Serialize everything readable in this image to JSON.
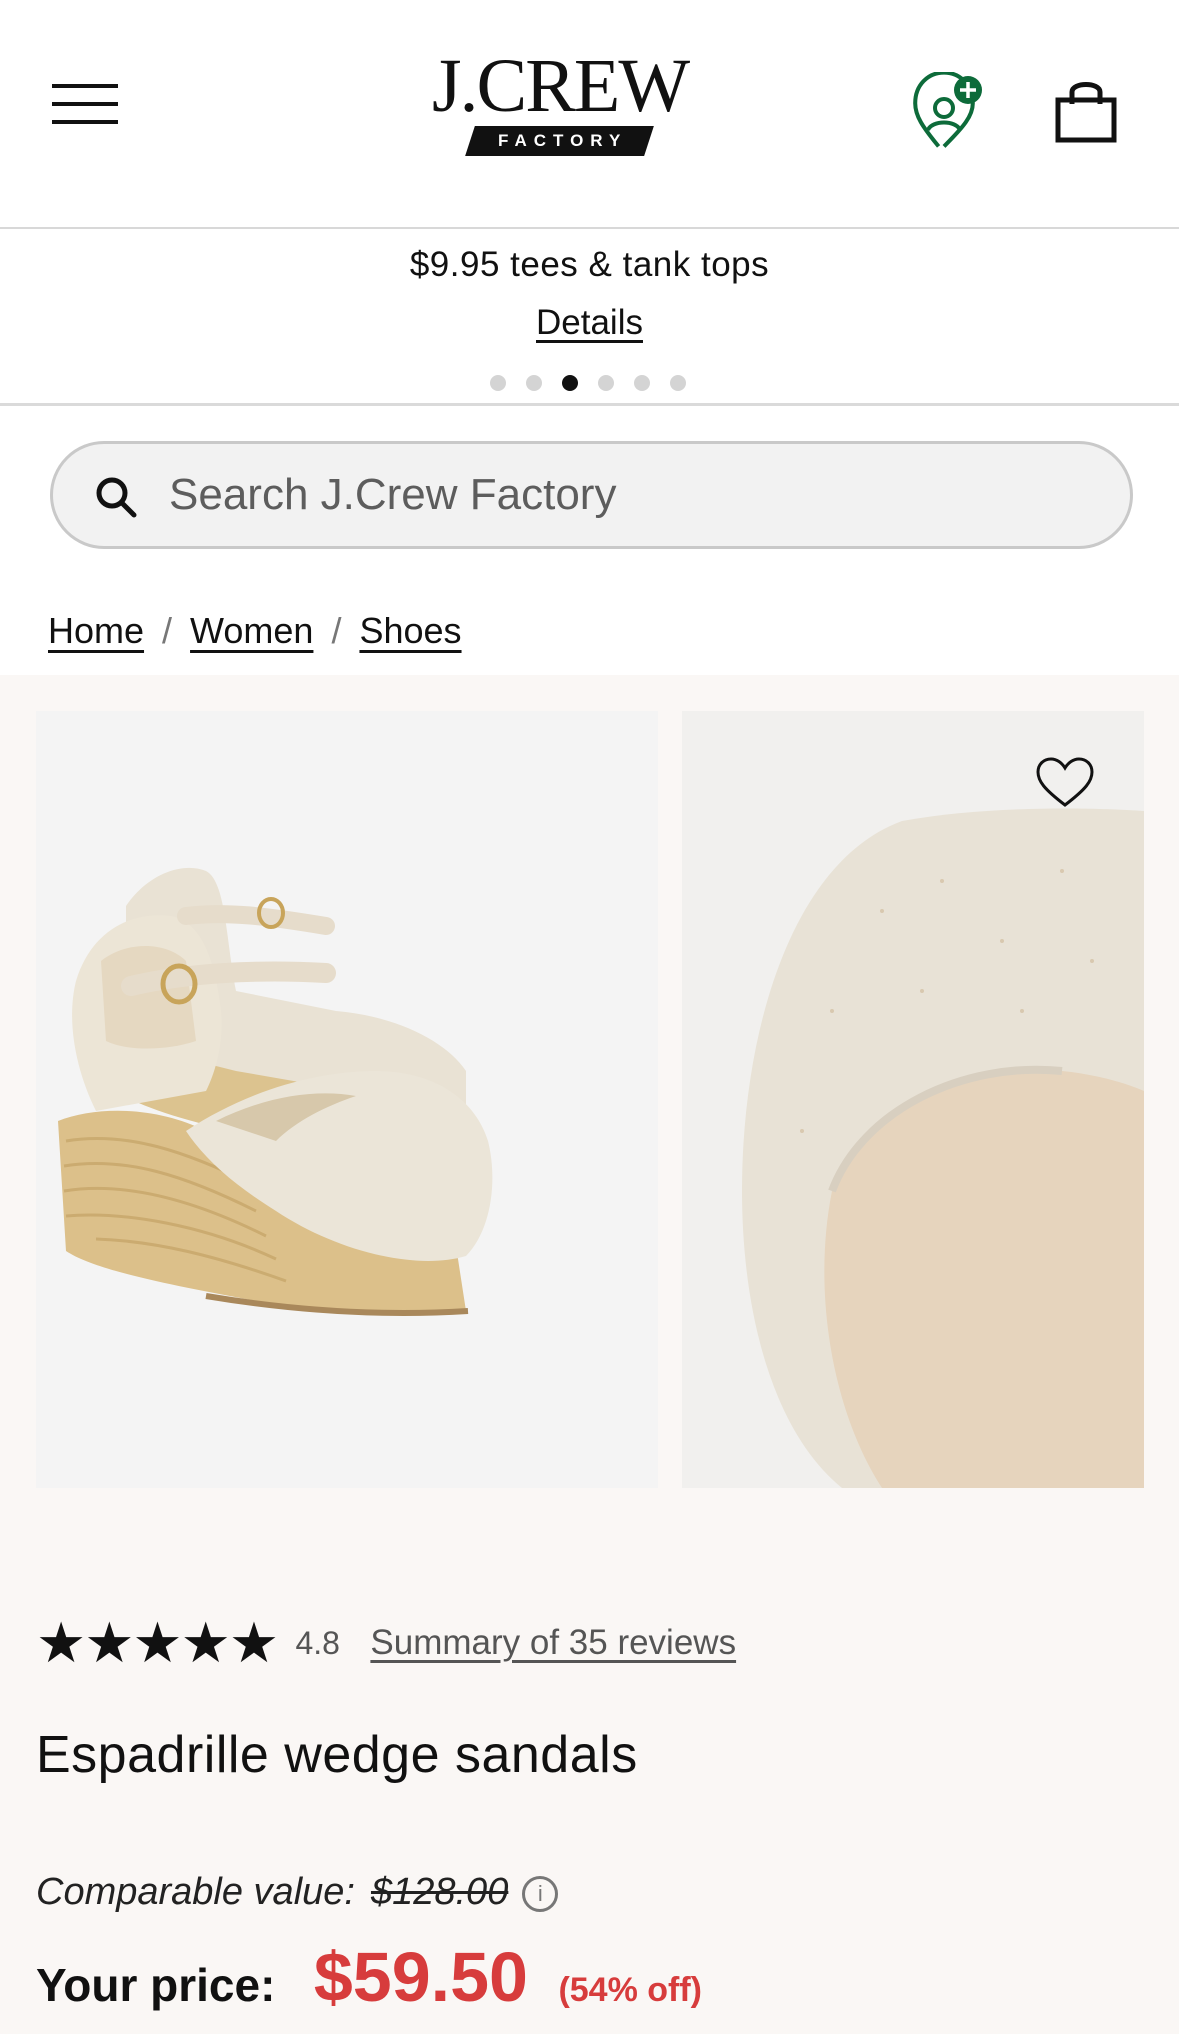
{
  "header": {
    "logo_word": "J.CREW",
    "logo_sub": "FACTORY",
    "accent_green": "#0d6b3a"
  },
  "promo": {
    "text": "$9.95 tees & tank tops",
    "link": "Details",
    "slide_count": 6,
    "active_slide": 3
  },
  "search": {
    "placeholder": "Search J.Crew Factory"
  },
  "breadcrumb": {
    "items": [
      "Home",
      "Women",
      "Shoes"
    ],
    "separator": "/"
  },
  "product": {
    "stars": "★★★★★",
    "rating": "4.8",
    "reviews_link": "Summary of 35 reviews",
    "title": "Espadrille wedge sandals",
    "comparable_label": "Comparable value:",
    "comparable_price": "$128.00",
    "info_glyph": "i",
    "price_label": "Your price:",
    "price": "$59.50",
    "discount": "(54% off)",
    "sale_color": "#d73c3c"
  }
}
